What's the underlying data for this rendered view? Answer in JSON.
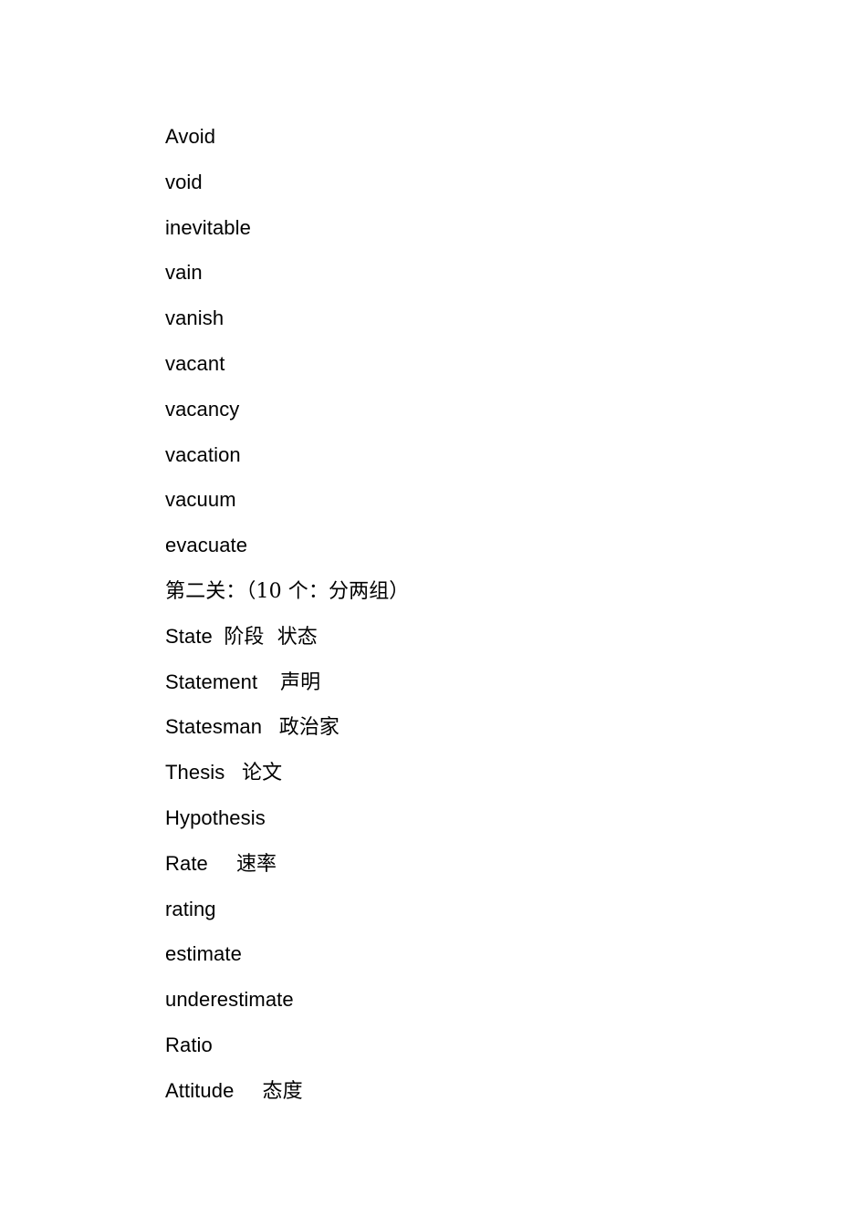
{
  "document": {
    "lines": [
      {
        "en": "Avoid",
        "gap": "",
        "cn": ""
      },
      {
        "en": "void",
        "gap": "",
        "cn": ""
      },
      {
        "en": "inevitable",
        "gap": "",
        "cn": ""
      },
      {
        "en": "vain",
        "gap": "",
        "cn": ""
      },
      {
        "en": "vanish",
        "gap": "",
        "cn": ""
      },
      {
        "en": "vacant",
        "gap": "",
        "cn": ""
      },
      {
        "en": "vacancy",
        "gap": "",
        "cn": ""
      },
      {
        "en": "vacation",
        "gap": "",
        "cn": ""
      },
      {
        "en": "vacuum",
        "gap": "",
        "cn": ""
      },
      {
        "en": "evacuate",
        "gap": "",
        "cn": ""
      },
      {
        "en": "",
        "gap": "",
        "cn": "第二关：（10 个：分两组）"
      },
      {
        "en": "State",
        "gap": "  ",
        "cn": "阶段  状态"
      },
      {
        "en": "Statement",
        "gap": "    ",
        "cn": "声明"
      },
      {
        "en": "Statesman",
        "gap": "   ",
        "cn": "政治家"
      },
      {
        "en": "Thesis",
        "gap": "   ",
        "cn": "论文"
      },
      {
        "en": "Hypothesis",
        "gap": "",
        "cn": ""
      },
      {
        "en": "Rate",
        "gap": "     ",
        "cn": "速率"
      },
      {
        "en": "rating",
        "gap": "",
        "cn": ""
      },
      {
        "en": "estimate",
        "gap": "",
        "cn": ""
      },
      {
        "en": "underestimate",
        "gap": "",
        "cn": ""
      },
      {
        "en": "Ratio",
        "gap": "",
        "cn": ""
      },
      {
        "en": "Attitude",
        "gap": "     ",
        "cn": "态度"
      }
    ]
  }
}
